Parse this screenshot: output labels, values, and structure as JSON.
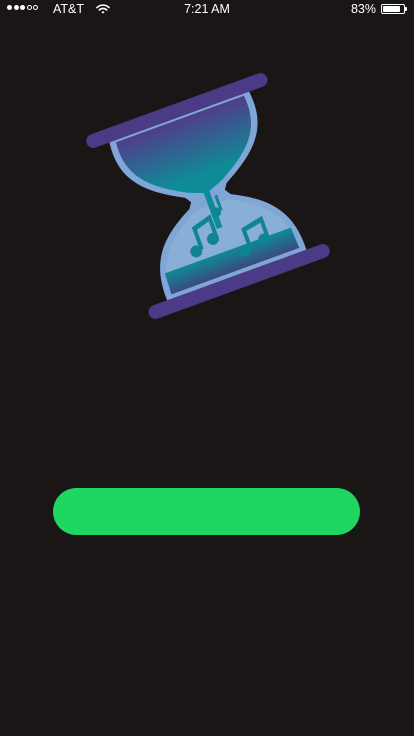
{
  "status_bar": {
    "signal_bars_filled": 3,
    "signal_bars_total": 5,
    "carrier": "AT&T",
    "wifi_icon": "wifi-icon",
    "time": "7:21 AM",
    "battery_percent_label": "83%",
    "battery_level": 0.83
  },
  "logo": {
    "icon": "hourglass-music-notes-icon",
    "colors": {
      "bar": "#4b3b86",
      "glass_outline": "#7fa6d6",
      "top_sand_from": "#503d8a",
      "top_sand_to": "#0f8a97",
      "bottom_glass": "#82a9d2",
      "bottom_sand": "#0f8a97",
      "notes": "#0f8493"
    }
  },
  "primary_button": {
    "label": "",
    "color": "#1ed660"
  },
  "background_color": "#1a1616"
}
